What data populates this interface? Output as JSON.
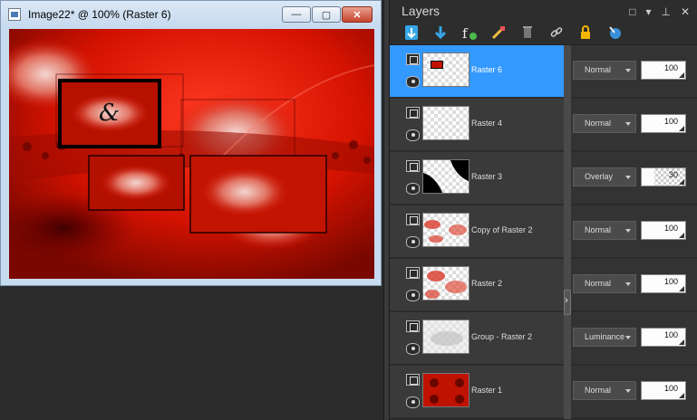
{
  "image_window": {
    "title": "Image22* @ 100% (Raster 6)",
    "buttons": {
      "minimize": "—",
      "maximize": "▢",
      "close": "✕"
    },
    "canvas_glyph": "&"
  },
  "layers_panel": {
    "title": "Layers",
    "controls": {
      "restore": "□",
      "menu": "▾",
      "pin": "⊥",
      "close": "✕"
    },
    "toolbar_icons": [
      "new-raster-layer-icon",
      "new-vector-layer-icon",
      "adjustment-layer-icon",
      "mask-icon",
      "delete-layer-icon",
      "link-icon",
      "lock-icon",
      "properties-icon"
    ],
    "layers": [
      {
        "name": "Raster 6",
        "blend": "Normal",
        "opacity": 100,
        "selected": true,
        "thumb": "raster6"
      },
      {
        "name": "Raster 4",
        "blend": "Normal",
        "opacity": 100,
        "selected": false,
        "thumb": "checker"
      },
      {
        "name": "Raster 3",
        "blend": "Overlay",
        "opacity": 30,
        "selected": false,
        "thumb": "raster3"
      },
      {
        "name": "Copy of Raster 2",
        "blend": "Normal",
        "opacity": 100,
        "selected": false,
        "thumb": "copy2"
      },
      {
        "name": "Raster 2",
        "blend": "Normal",
        "opacity": 100,
        "selected": false,
        "thumb": "raster2"
      },
      {
        "name": "Group - Raster 2",
        "blend": "Luminance",
        "opacity": 100,
        "selected": false,
        "thumb": "group"
      },
      {
        "name": "Raster 1",
        "blend": "Normal",
        "opacity": 100,
        "selected": false,
        "thumb": "raster1"
      }
    ]
  },
  "colors": {
    "accent": "#3399ff",
    "canvas_red": "#c51200"
  }
}
